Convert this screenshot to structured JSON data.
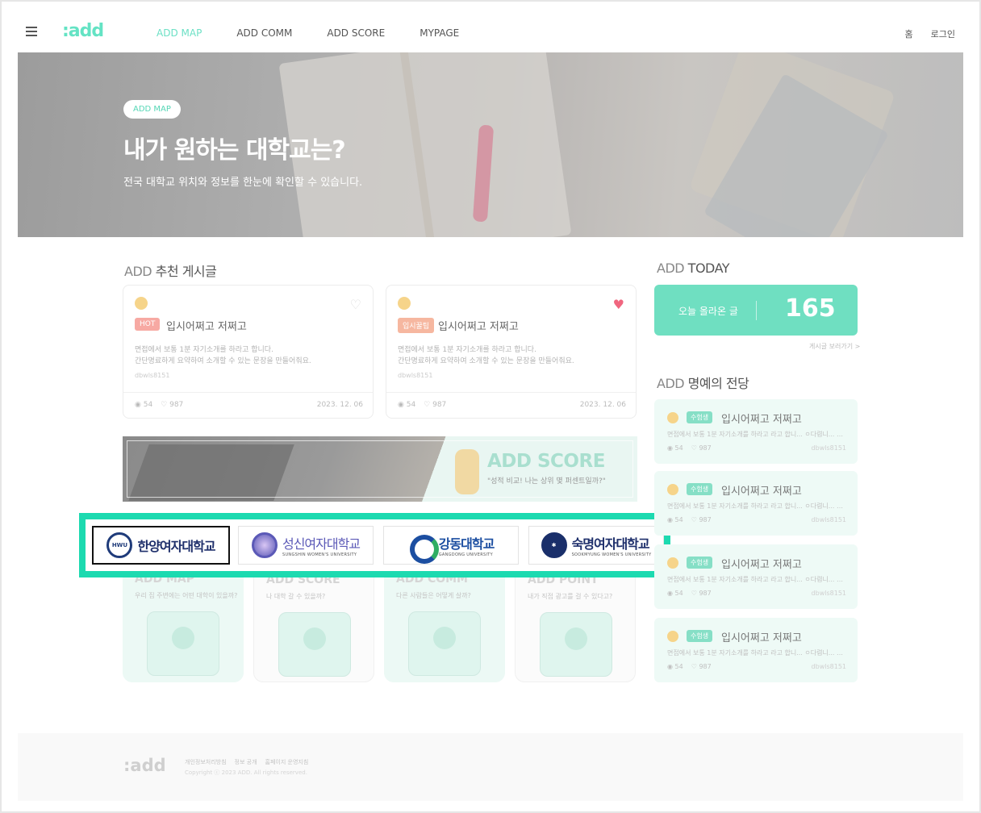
{
  "header": {
    "logo": ":add",
    "nav": [
      "ADD MAP",
      "ADD COMM",
      "ADD SCORE",
      "MYPAGE"
    ],
    "home": "홈",
    "login": "로그인"
  },
  "hero": {
    "badge": "ADD MAP",
    "title": "내가 원하는 대학교는?",
    "subtitle": "전국 대학교 위치와 정보를 한눈에 확인할 수 있습니다."
  },
  "recommended": {
    "title_prefix": "ADD",
    "title": " 추천 게시글",
    "cards": [
      {
        "tag": "HOT",
        "title": "입시어쩌고 저쩌고",
        "desc1": "면접에서 보통 1분 자기소개를 하라고 합니다.",
        "desc2": "간단명료하게 요약하여 소개할 수 있는 문장을 만들어줘요.",
        "author": "dbwls8151",
        "views": "54",
        "likes": "987",
        "date": "2023. 12. 06"
      },
      {
        "tag": "입시꿀팁",
        "title": "입시어쩌고 저쩌고",
        "desc1": "면접에서 보통 1분 자기소개를 하라고 합니다.",
        "desc2": "간단명료하게 요약하여 소개할 수 있는 문장을 만들어줘요.",
        "author": "dbwls8151",
        "views": "54",
        "likes": "987",
        "date": "2023. 12. 06"
      }
    ]
  },
  "banner": {
    "title": "ADD SCORE",
    "subtitle": "\"성적 비교! 나는 상위 몇 퍼센트일까?\""
  },
  "universities": [
    {
      "name": "한양여자대학교",
      "english": "",
      "seal": "HWU"
    },
    {
      "name": "성신여자대학교",
      "english": "SUNGSHIN WOMEN'S UNIVERSITY",
      "seal": ""
    },
    {
      "name": "강동대학교",
      "english": "GANGDONG UNIVERSITY",
      "seal": ""
    },
    {
      "name": "숙명여자대학교",
      "english": "SOOKMYUNG WOMEN'S UNIVERSITY",
      "seal": ""
    }
  ],
  "services": [
    {
      "title": "ADD MAP",
      "sub": "우리 집 주변에는 어떤 대학이 있을까?"
    },
    {
      "title": "ADD SCORE",
      "sub": "나 대학 갈 수 있을까?"
    },
    {
      "title": "ADD COMM",
      "sub": "다른 사람들은 어떻게 살까?"
    },
    {
      "title": "ADD POINT",
      "sub": "내가 직접 광고를 걸 수 있다고?"
    }
  ],
  "today": {
    "title_prefix": "ADD",
    "title": " TODAY",
    "label": "오늘 올라온 글",
    "count": "165",
    "more": "게시글 보러가기 >"
  },
  "fame": {
    "title_prefix": "ADD",
    "title": " 명예의 전당",
    "items": [
      {
        "tag": "수험생",
        "title": "입시어쩌고 저쩌고",
        "desc": "면접에서 보통 1분 자기소개를 하라고 라고 합니... ㅇ다렴니... ㅇ다...",
        "views": "54",
        "likes": "987",
        "author": "dbwls8151"
      },
      {
        "tag": "수험생",
        "title": "입시어쩌고 저쩌고",
        "desc": "면접에서 보통 1분 자기소개를 하라고 라고 합니... ㅇ다렴니... ㅇ다...",
        "views": "54",
        "likes": "987",
        "author": "dbwls8151"
      },
      {
        "tag": "수험생",
        "title": "입시어쩌고 저쩌고",
        "desc": "면접에서 보통 1분 자기소개를 하라고 라고 합니... ㅇ다렴니... ㅇ다...",
        "views": "54",
        "likes": "987",
        "author": "dbwls8151"
      },
      {
        "tag": "수험생",
        "title": "입시어쩌고 저쩌고",
        "desc": "면접에서 보통 1분 자기소개를 하라고 라고 합니... ㅇ다렴니... ㅇ다...",
        "views": "54",
        "likes": "987",
        "author": "dbwls8151"
      }
    ]
  },
  "footer": {
    "logo": ":add",
    "links": [
      "개인정보처리방침",
      "정보 공개",
      "홈페이지 운영지침"
    ],
    "copyright": "Copyright ⓒ 2023 ADD. All rights reserved."
  },
  "colors": {
    "accent": "#6ce0c5",
    "highlight": "#1cdab0",
    "heart": "#f0667f"
  }
}
